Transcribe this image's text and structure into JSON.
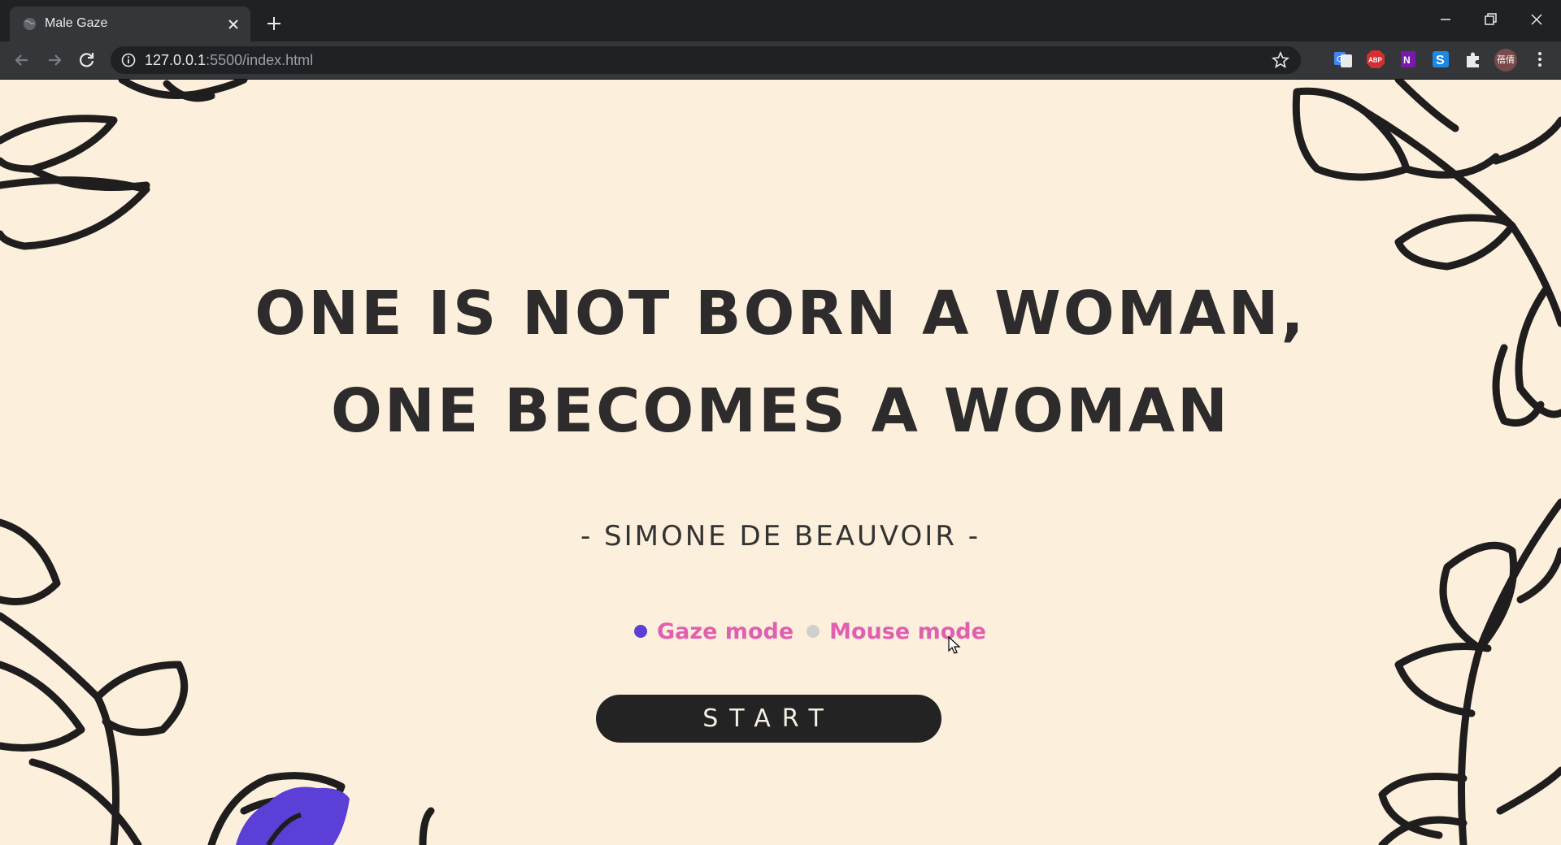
{
  "browser": {
    "tab_title": "Male Gaze",
    "url_host": "127.0.0.1",
    "url_rest": ":5500/index.html",
    "extensions": [
      "translate-icon",
      "adblock-icon",
      "onenote-icon",
      "s-extension-icon",
      "puzzle-icon",
      "profile-avatar",
      "menu-icon"
    ],
    "profile_label": "蓓倩"
  },
  "page": {
    "quote_line1": "ONE IS NOT BORN A WOMAN,",
    "quote_line2": "ONE BECOMES A WOMAN",
    "author": "- SIMONE DE BEAUVOIR -",
    "modes": [
      {
        "label": "Gaze mode",
        "selected": true,
        "color": "#5b3fd6"
      },
      {
        "label": "Mouse mode",
        "selected": false,
        "color": "#cfcfcf"
      }
    ],
    "start_label": "START"
  },
  "colors": {
    "background": "#fcf0dc",
    "text": "#2d2b2b",
    "mode_text": "#e060b0",
    "button": "#242323",
    "flower": "#5b3fd6"
  }
}
